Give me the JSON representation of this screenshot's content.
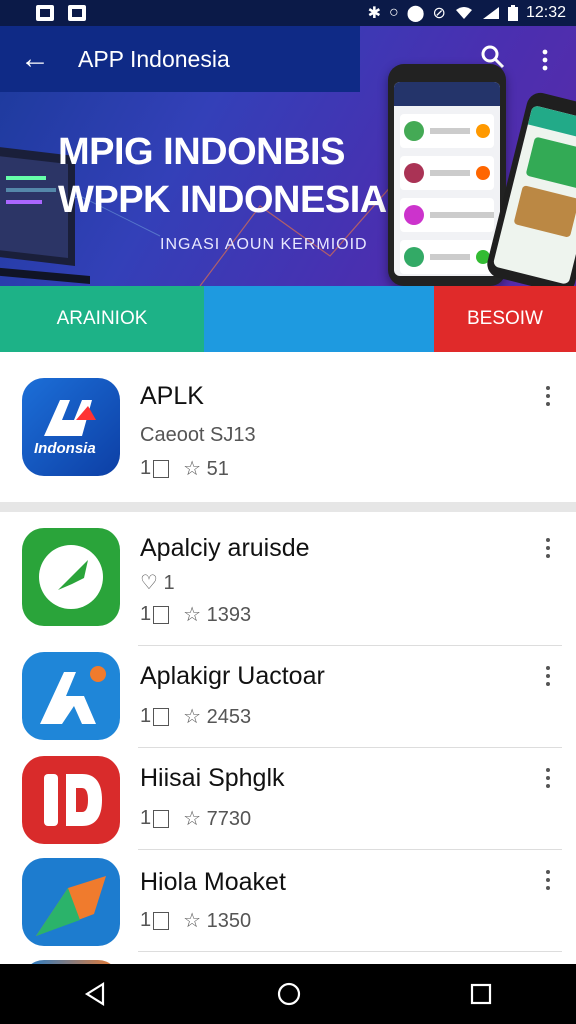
{
  "status_bar": {
    "time": "12:32",
    "icons": [
      "notification-icon",
      "photo-icon",
      "bluetooth-icon",
      "alarm-icon",
      "circle-icon",
      "vibrate-icon",
      "wifi-icon",
      "signal-icon",
      "battery-icon"
    ]
  },
  "header": {
    "title": "APP Indonesia",
    "headline_line1": "MPIG INDONBIS",
    "headline_line2": "WPPK INDONESIA",
    "subline": "INGASI AOUN KERMIOID"
  },
  "tabs": [
    {
      "label": "ARAINIOK",
      "color": "#1db287"
    },
    {
      "label": "",
      "color": "#1e9ae0"
    },
    {
      "label": "BESOIW",
      "color": "#e02a2a"
    }
  ],
  "featured": {
    "title": "APLK",
    "subtitle": "Caeoot SJ13",
    "downloads_icon": "1",
    "rating": "51",
    "icon_text": "Indonsia"
  },
  "apps": [
    {
      "title": "Apalciy aruisde",
      "extra": "1",
      "downloads_icon": "1",
      "rating": "1393"
    },
    {
      "title": "Aplakigr Uactoar",
      "downloads_icon": "1",
      "rating": "2453"
    },
    {
      "title": "Hiisai Sphglk",
      "downloads_icon": "1",
      "rating": "7730"
    },
    {
      "title": "Hiola Moaket",
      "downloads_icon": "1",
      "rating": "1350"
    }
  ],
  "colors": {
    "primary": "#0f2a86",
    "accent": "#1e9ae0",
    "green": "#1db287",
    "red": "#e02a2a"
  }
}
